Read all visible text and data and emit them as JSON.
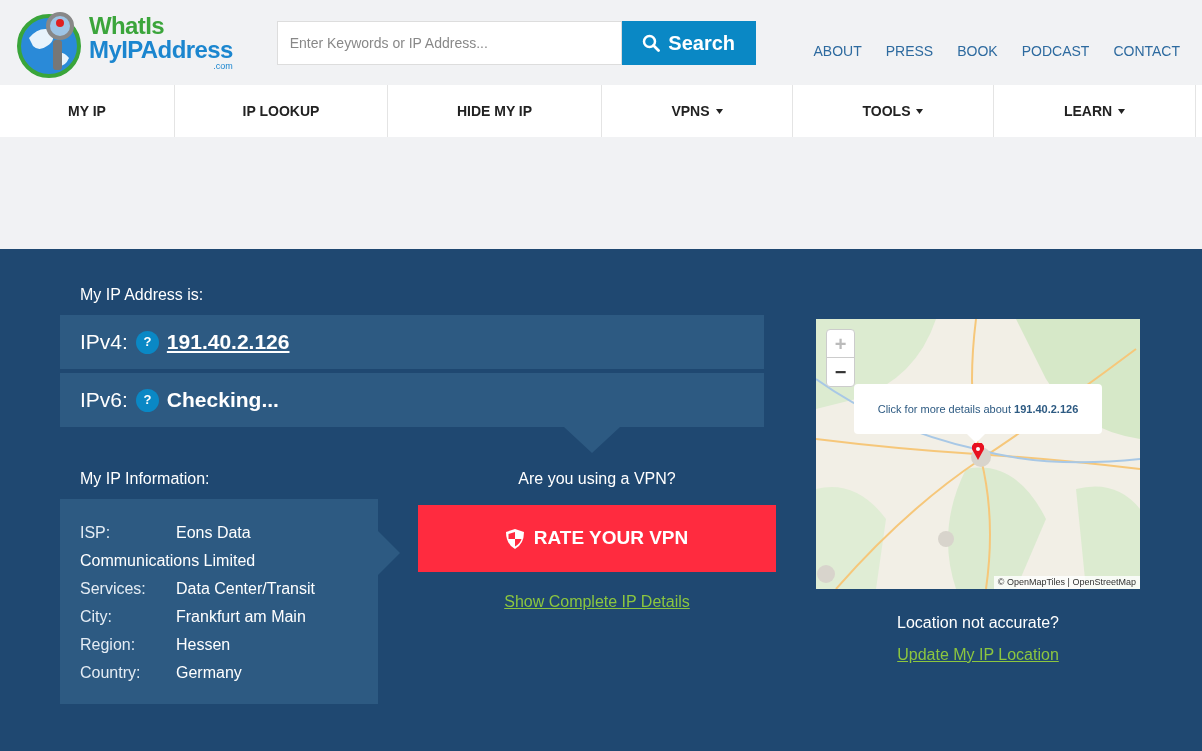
{
  "logo": {
    "line_1": "WhatIs",
    "line_2": "MyIPAddress",
    "suffix": ".com"
  },
  "search": {
    "placeholder": "Enter Keywords or IP Address...",
    "button": "Search"
  },
  "top_links": [
    "ABOUT",
    "PRESS",
    "BOOK",
    "PODCAST",
    "CONTACT"
  ],
  "nav": [
    {
      "label": "MY IP",
      "dropdown": false
    },
    {
      "label": "IP LOOKUP",
      "dropdown": false
    },
    {
      "label": "HIDE MY IP",
      "dropdown": false
    },
    {
      "label": "VPNS",
      "dropdown": true
    },
    {
      "label": "TOOLS",
      "dropdown": true
    },
    {
      "label": "LEARN",
      "dropdown": true
    }
  ],
  "ip_heading": "My IP Address is:",
  "ip_rows": [
    {
      "label": "IPv4:",
      "help": "?",
      "value": "191.40.2.126",
      "kind": "link"
    },
    {
      "label": "IPv6:",
      "help": "?",
      "value": "Checking...",
      "kind": "status"
    }
  ],
  "info_heading": "My IP Information:",
  "info_rows": [
    {
      "label": "ISP:",
      "value": "Eons Data Communications Limited"
    },
    {
      "label": "Services:",
      "value": "Data Center/Transit"
    },
    {
      "label": "City:",
      "value": "Frankfurt am Main"
    },
    {
      "label": "Region:",
      "value": "Hessen"
    },
    {
      "label": "Country:",
      "value": "Germany"
    }
  ],
  "vpn": {
    "question": "Are you using a VPN?",
    "button": "RATE YOUR VPN",
    "details_link": "Show Complete IP Details"
  },
  "map": {
    "zoom_in": "+",
    "zoom_out": "−",
    "popup_text": "Click for more details about **191.40.2.126**",
    "attribution": "© OpenMapTiles | OpenStreetMap"
  },
  "location": {
    "question": "Location not accurate?",
    "link": "Update My IP Location"
  }
}
